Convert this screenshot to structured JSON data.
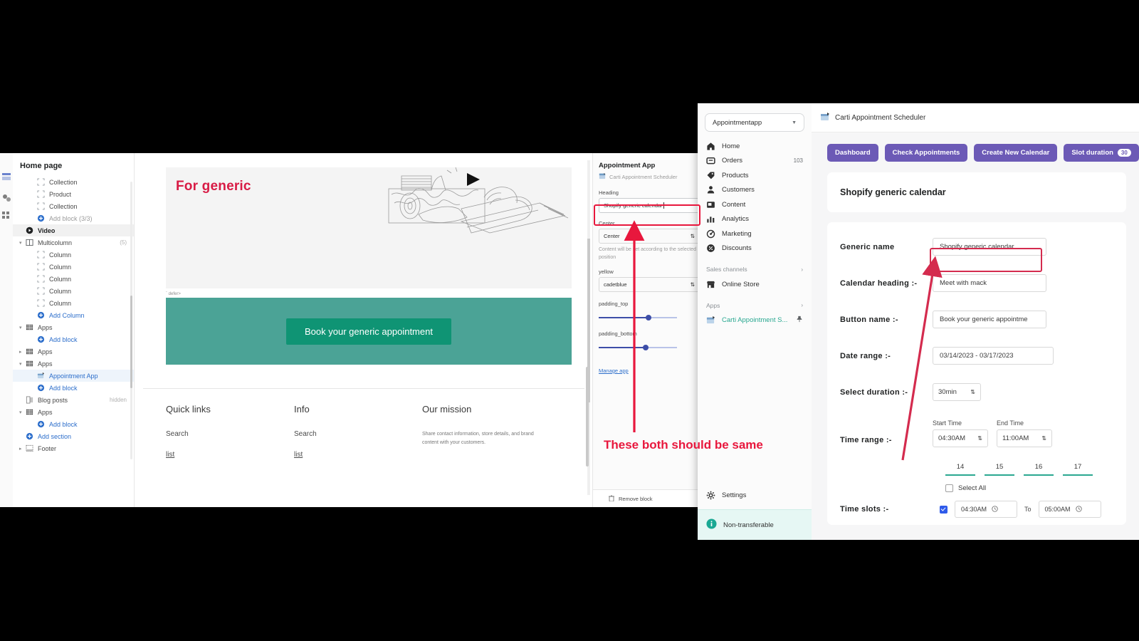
{
  "theme_editor": {
    "sidebar": {
      "title": "Home page",
      "items": [
        {
          "label": "Collection",
          "icon": "block-icon",
          "indent": 1,
          "state": "normal"
        },
        {
          "label": "Product",
          "icon": "block-icon",
          "indent": 1,
          "state": "normal"
        },
        {
          "label": "Collection",
          "icon": "block-icon",
          "indent": 1,
          "state": "normal"
        },
        {
          "label": "Add block (3/3)",
          "icon": "plus-icon",
          "indent": 1,
          "state": "disabled"
        },
        {
          "label": "Video",
          "icon": "video-icon",
          "indent": 0,
          "state": "selected"
        },
        {
          "label": "Multicolumn",
          "icon": "multicolumn-icon",
          "indent": 0,
          "state": "normal",
          "count": "(5)",
          "caret": "down"
        },
        {
          "label": "Column",
          "icon": "block-icon",
          "indent": 1,
          "state": "normal"
        },
        {
          "label": "Column",
          "icon": "block-icon",
          "indent": 1,
          "state": "normal"
        },
        {
          "label": "Column",
          "icon": "block-icon",
          "indent": 1,
          "state": "normal"
        },
        {
          "label": "Column",
          "icon": "block-icon",
          "indent": 1,
          "state": "normal"
        },
        {
          "label": "Column",
          "icon": "block-icon",
          "indent": 1,
          "state": "normal"
        },
        {
          "label": "Add Column",
          "icon": "plus-icon",
          "indent": 1,
          "state": "link"
        },
        {
          "label": "Apps",
          "icon": "apps-icon",
          "indent": 0,
          "state": "normal",
          "caret": "down"
        },
        {
          "label": "Add block",
          "icon": "plus-icon",
          "indent": 1,
          "state": "link"
        },
        {
          "label": "Apps",
          "icon": "apps-icon",
          "indent": 0,
          "state": "normal",
          "caret": "right"
        },
        {
          "label": "Apps",
          "icon": "apps-icon",
          "indent": 0,
          "state": "normal",
          "caret": "down"
        },
        {
          "label": "Appointment App",
          "icon": "calendar-app-icon",
          "indent": 1,
          "state": "app-selected"
        },
        {
          "label": "Add block",
          "icon": "plus-icon",
          "indent": 1,
          "state": "link"
        },
        {
          "label": "Blog posts",
          "icon": "blog-icon",
          "indent": 0,
          "state": "normal",
          "count": "hidden"
        },
        {
          "label": "Apps",
          "icon": "apps-icon",
          "indent": 0,
          "state": "normal",
          "caret": "down"
        },
        {
          "label": "Add block",
          "icon": "plus-icon",
          "indent": 1,
          "state": "link"
        },
        {
          "label": "Add section",
          "icon": "plus-icon",
          "indent": 0,
          "state": "link"
        },
        {
          "label": "Footer",
          "icon": "footer-icon",
          "indent": 0,
          "state": "normal",
          "caret": "right"
        }
      ]
    },
    "preview": {
      "annotation_for_generic": "For generic",
      "defer_text": "` defer>",
      "book_button": "Book your generic appointment",
      "footer_columns": [
        {
          "heading": "Quick links",
          "links": [
            "Search",
            "list"
          ]
        },
        {
          "heading": "Info",
          "links": [
            "Search",
            "list"
          ]
        },
        {
          "heading": "Our mission",
          "paragraph": "Share contact information, store details, and brand content with your customers."
        }
      ]
    },
    "settings_panel": {
      "block_title": "Appointment App",
      "app_name": "Carti Appointment Scheduler",
      "heading_label": "Heading",
      "heading_value": "Shopify generic calendar",
      "position_label": "Center",
      "position_value": "Center",
      "position_help": "Content will be set according to the selected position",
      "color_label": "yellow",
      "color_value": "cadetblue",
      "padding_top_label": "padding_top",
      "padding_top_value": "56px",
      "padding_bottom_label": "padding_bottom",
      "padding_bottom_value": "52px",
      "manage_app": "Manage app",
      "remove_block": "Remove block"
    },
    "annotation_note": "These both should be same"
  },
  "admin": {
    "store_switcher": "Appointmentapp",
    "nav_items": [
      {
        "label": "Home",
        "icon": "home-icon"
      },
      {
        "label": "Orders",
        "icon": "orders-icon",
        "badge": "103"
      },
      {
        "label": "Products",
        "icon": "products-icon"
      },
      {
        "label": "Customers",
        "icon": "customers-icon"
      },
      {
        "label": "Content",
        "icon": "content-icon"
      },
      {
        "label": "Analytics",
        "icon": "analytics-icon"
      },
      {
        "label": "Marketing",
        "icon": "marketing-icon"
      },
      {
        "label": "Discounts",
        "icon": "discounts-icon"
      }
    ],
    "group_sales_channels": "Sales channels",
    "online_store": "Online Store",
    "group_apps": "Apps",
    "active_app": "Carti Appointment S...",
    "settings": "Settings",
    "non_transferable": "Non-transferable",
    "topbar_app_title": "Carti Appointment Scheduler",
    "buttons": [
      {
        "label": "Dashboard"
      },
      {
        "label": "Check Appointments"
      },
      {
        "label": "Create New Calendar"
      },
      {
        "label": "Slot duration",
        "badge": "30"
      }
    ],
    "card_title": "Shopify generic calendar",
    "form": {
      "generic_name_label": "Generic name",
      "generic_name_value": "Shopify generic calendar",
      "calendar_heading_label": "Calendar heading :-",
      "calendar_heading_value": "Meet with mack",
      "button_name_label": "Button name :-",
      "button_name_value": "Book your generic appointme",
      "date_range_label": "Date range :-",
      "date_range_value": "03/14/2023 - 03/17/2023",
      "select_duration_label": "Select duration :-",
      "select_duration_value": "30min",
      "time_range_label": "Time range :-",
      "start_time_label": "Start Time",
      "start_time_value": "04:30AM",
      "end_time_label": "End Time",
      "end_time_value": "11:00AM",
      "days": [
        "14",
        "15",
        "16",
        "17"
      ],
      "select_all_label": "Select All",
      "time_slots_label": "Time slots :-",
      "slot_from": "04:30AM",
      "slot_to_label": "To",
      "slot_to": "05:00AM"
    }
  },
  "colors": {
    "annotation_red": "#e8173d",
    "admin_purple": "#6c5ab6",
    "teal_band": "#4ba396",
    "green_button": "#0f9474",
    "shopify_link": "#2c6ecb"
  }
}
